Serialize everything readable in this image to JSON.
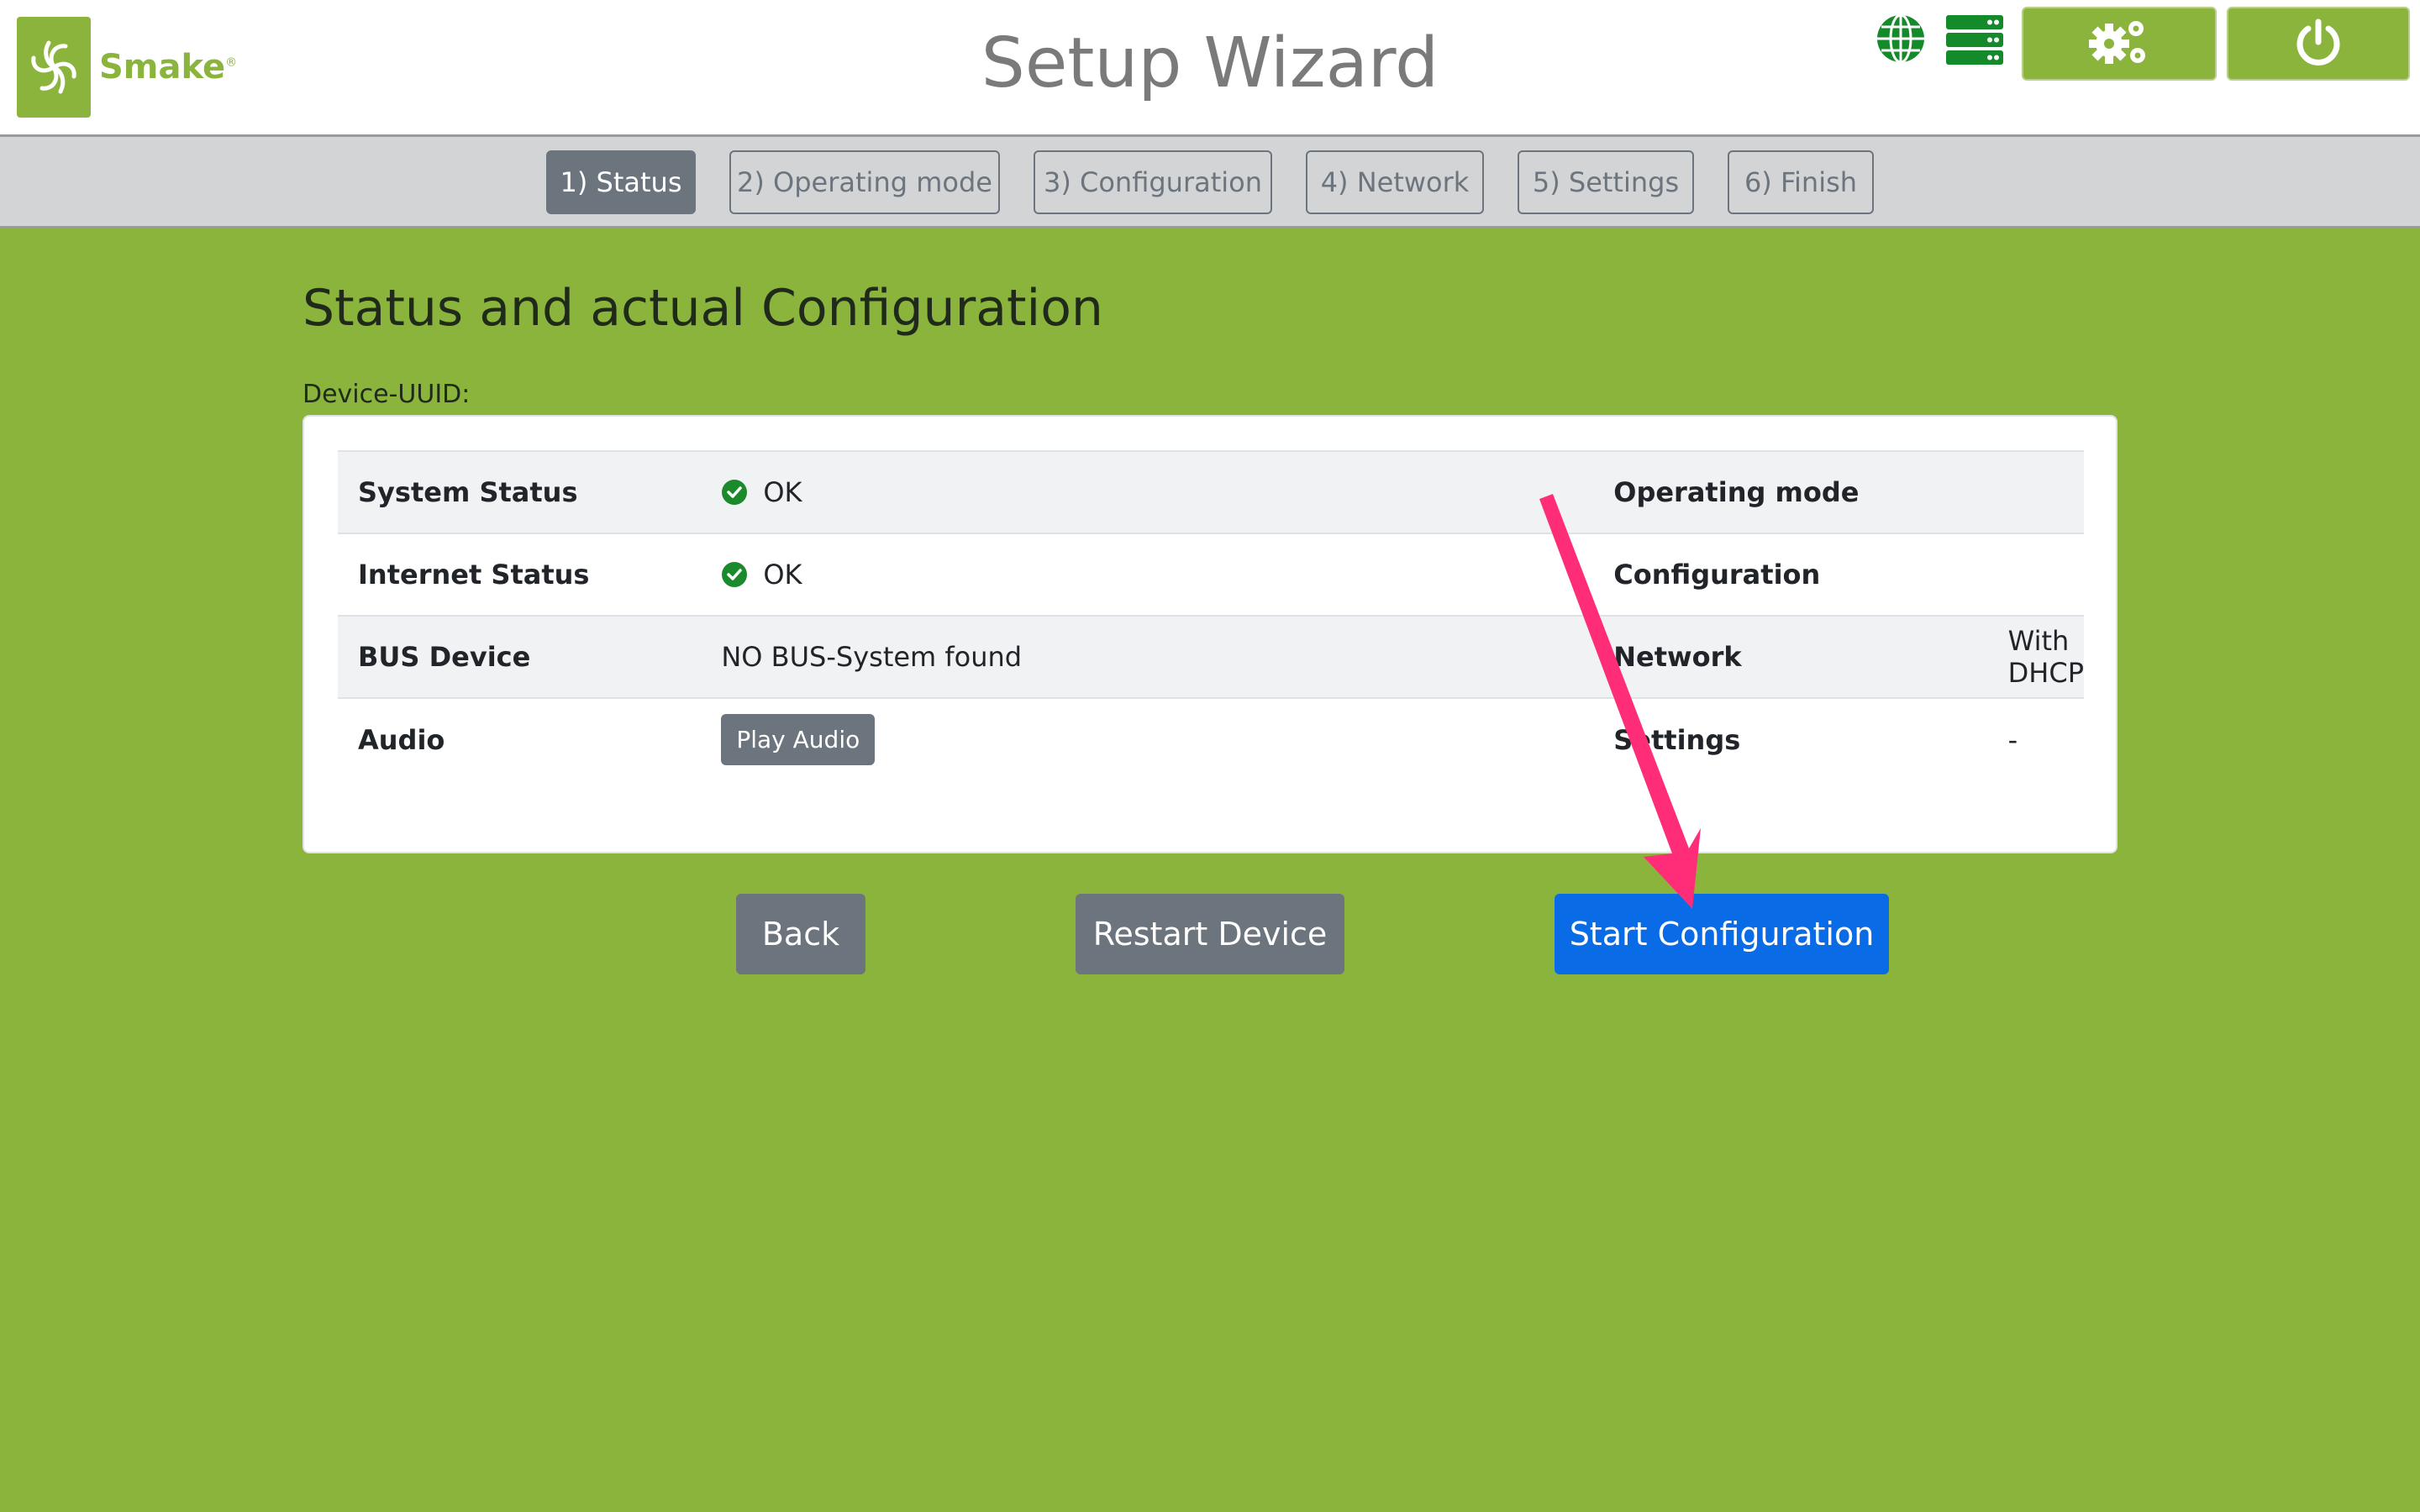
{
  "header": {
    "brand": "Smake",
    "brand_reg": "®",
    "title": "Setup Wizard",
    "icons": [
      "globe-icon",
      "server-icon",
      "settings-gears-icon",
      "power-icon"
    ]
  },
  "tabs": [
    {
      "label": "1) Status",
      "active": true
    },
    {
      "label": "2) Operating mode",
      "active": false
    },
    {
      "label": "3) Configuration",
      "active": false
    },
    {
      "label": "4) Network",
      "active": false
    },
    {
      "label": "5) Settings",
      "active": false
    },
    {
      "label": "6) Finish",
      "active": false
    }
  ],
  "main": {
    "heading": "Status and actual Configuration",
    "uuid_label": "Device-UUID:",
    "rows": [
      {
        "label": "System Status",
        "value": "OK",
        "status_icon": "check-icon",
        "right_label": "Operating mode",
        "right_value": ""
      },
      {
        "label": "Internet Status",
        "value": "OK",
        "status_icon": "check-icon",
        "right_label": "Configuration",
        "right_value": ""
      },
      {
        "label": "BUS Device",
        "value": "NO BUS-System found",
        "right_label": "Network",
        "right_value": "With DHCP"
      },
      {
        "label": "Audio",
        "button": "Play Audio",
        "right_label": "Settings",
        "right_value": "-"
      }
    ]
  },
  "actions": {
    "back": "Back",
    "restart": "Restart Device",
    "start": "Start Configuration"
  },
  "colors": {
    "background": "#8bb43c",
    "primary": "#0a6be6",
    "secondary": "#6c757d",
    "check": "#1a8a2c",
    "annotation_arrow": "#ff2d78"
  }
}
